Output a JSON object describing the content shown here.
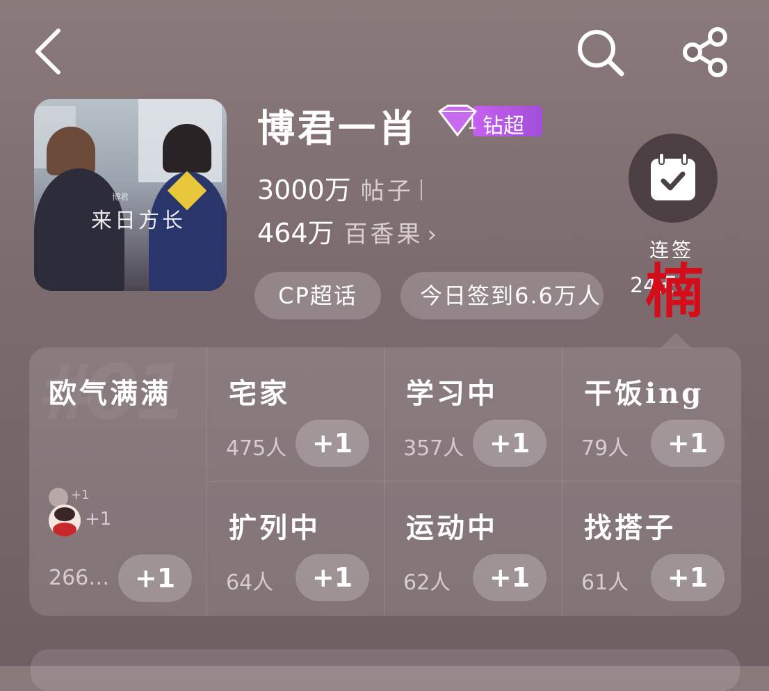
{
  "header": {
    "back_icon": "chevron-left-icon",
    "search_icon": "search-icon",
    "share_icon": "share-icon"
  },
  "topic": {
    "cover_caption": "来日方长",
    "cover_caption_small": "博君",
    "title": "博君一肖",
    "badge_level": "1",
    "badge_label": "钻超",
    "posts_value": "3000万",
    "posts_label": "帖子",
    "fans_value": "464万",
    "fans_label": "百香果",
    "fans_chevron": "›"
  },
  "pills": {
    "category": "CP超话",
    "checkins_today": "今日签到6.6万人"
  },
  "checkin": {
    "icon": "calendar-check-icon",
    "label": "连签",
    "days": "24天",
    "stamp": "楠"
  },
  "panel": {
    "watermark": "#01",
    "featured": {
      "name": "欧气满满",
      "avatar_plus_small": "+1",
      "avatar_plus": "+1",
      "count": "266…",
      "button": "+1"
    },
    "statuses": [
      {
        "name": "宅家",
        "count": "475人",
        "button": "+1"
      },
      {
        "name": "学习中",
        "count": "357人",
        "button": "+1"
      },
      {
        "name": "干饭ing",
        "count": "79人",
        "button": "+1"
      },
      {
        "name": "扩列中",
        "count": "64人",
        "button": "+1"
      },
      {
        "name": "运动中",
        "count": "62人",
        "button": "+1"
      },
      {
        "name": "找搭子",
        "count": "61人",
        "button": "+1"
      }
    ]
  },
  "colors": {
    "badge": "#b457e4",
    "stamp": "#d40d1b",
    "checkin_circle": "#4b3f44"
  }
}
